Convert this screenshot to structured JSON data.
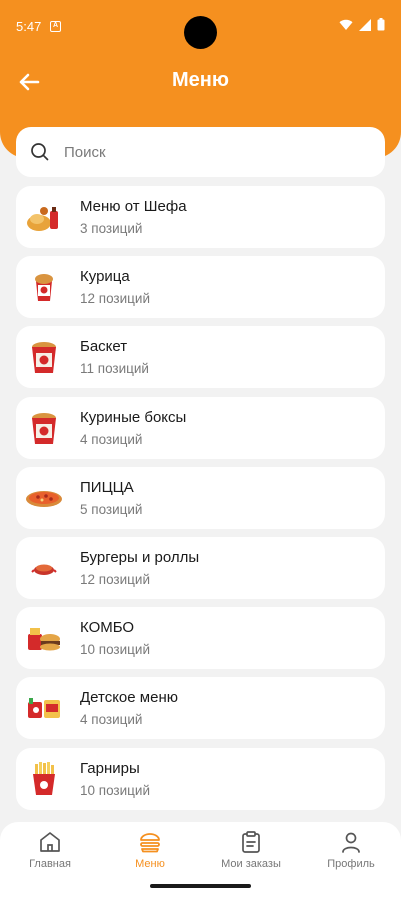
{
  "status_bar": {
    "time": "5:47",
    "notification_glyph": "A"
  },
  "header": {
    "title": "Меню",
    "back_icon": "arrow-left-icon"
  },
  "search": {
    "placeholder": "Поиск"
  },
  "categories": [
    {
      "name": "Меню от Шефа",
      "count": "3 позиций",
      "icon": "chef-menu-icon"
    },
    {
      "name": "Курица",
      "count": "12 позиций",
      "icon": "chicken-icon"
    },
    {
      "name": "Баскет",
      "count": "11 позиций",
      "icon": "basket-icon"
    },
    {
      "name": "Куриные боксы",
      "count": "4 позиций",
      "icon": "chicken-box-icon"
    },
    {
      "name": "ПИЦЦА",
      "count": "5 позиций",
      "icon": "pizza-icon"
    },
    {
      "name": "Бургеры и роллы",
      "count": "12 позиций",
      "icon": "burger-roll-icon"
    },
    {
      "name": "КОМБО",
      "count": "10 позиций",
      "icon": "combo-icon"
    },
    {
      "name": "Детское меню",
      "count": "4 позиций",
      "icon": "kids-menu-icon"
    },
    {
      "name": "Гарниры",
      "count": "10 позиций",
      "icon": "fries-icon"
    }
  ],
  "bottom_nav": {
    "items": [
      {
        "label": "Главная",
        "icon": "home-icon",
        "active": false
      },
      {
        "label": "Меню",
        "icon": "burger-icon",
        "active": true
      },
      {
        "label": "Мои заказы",
        "icon": "clipboard-icon",
        "active": false
      },
      {
        "label": "Профиль",
        "icon": "user-icon",
        "active": false
      }
    ]
  },
  "colors": {
    "accent": "#f5901f",
    "background": "#f2f2f2",
    "card": "#ffffff",
    "secondary_text": "#7a7a7a"
  }
}
